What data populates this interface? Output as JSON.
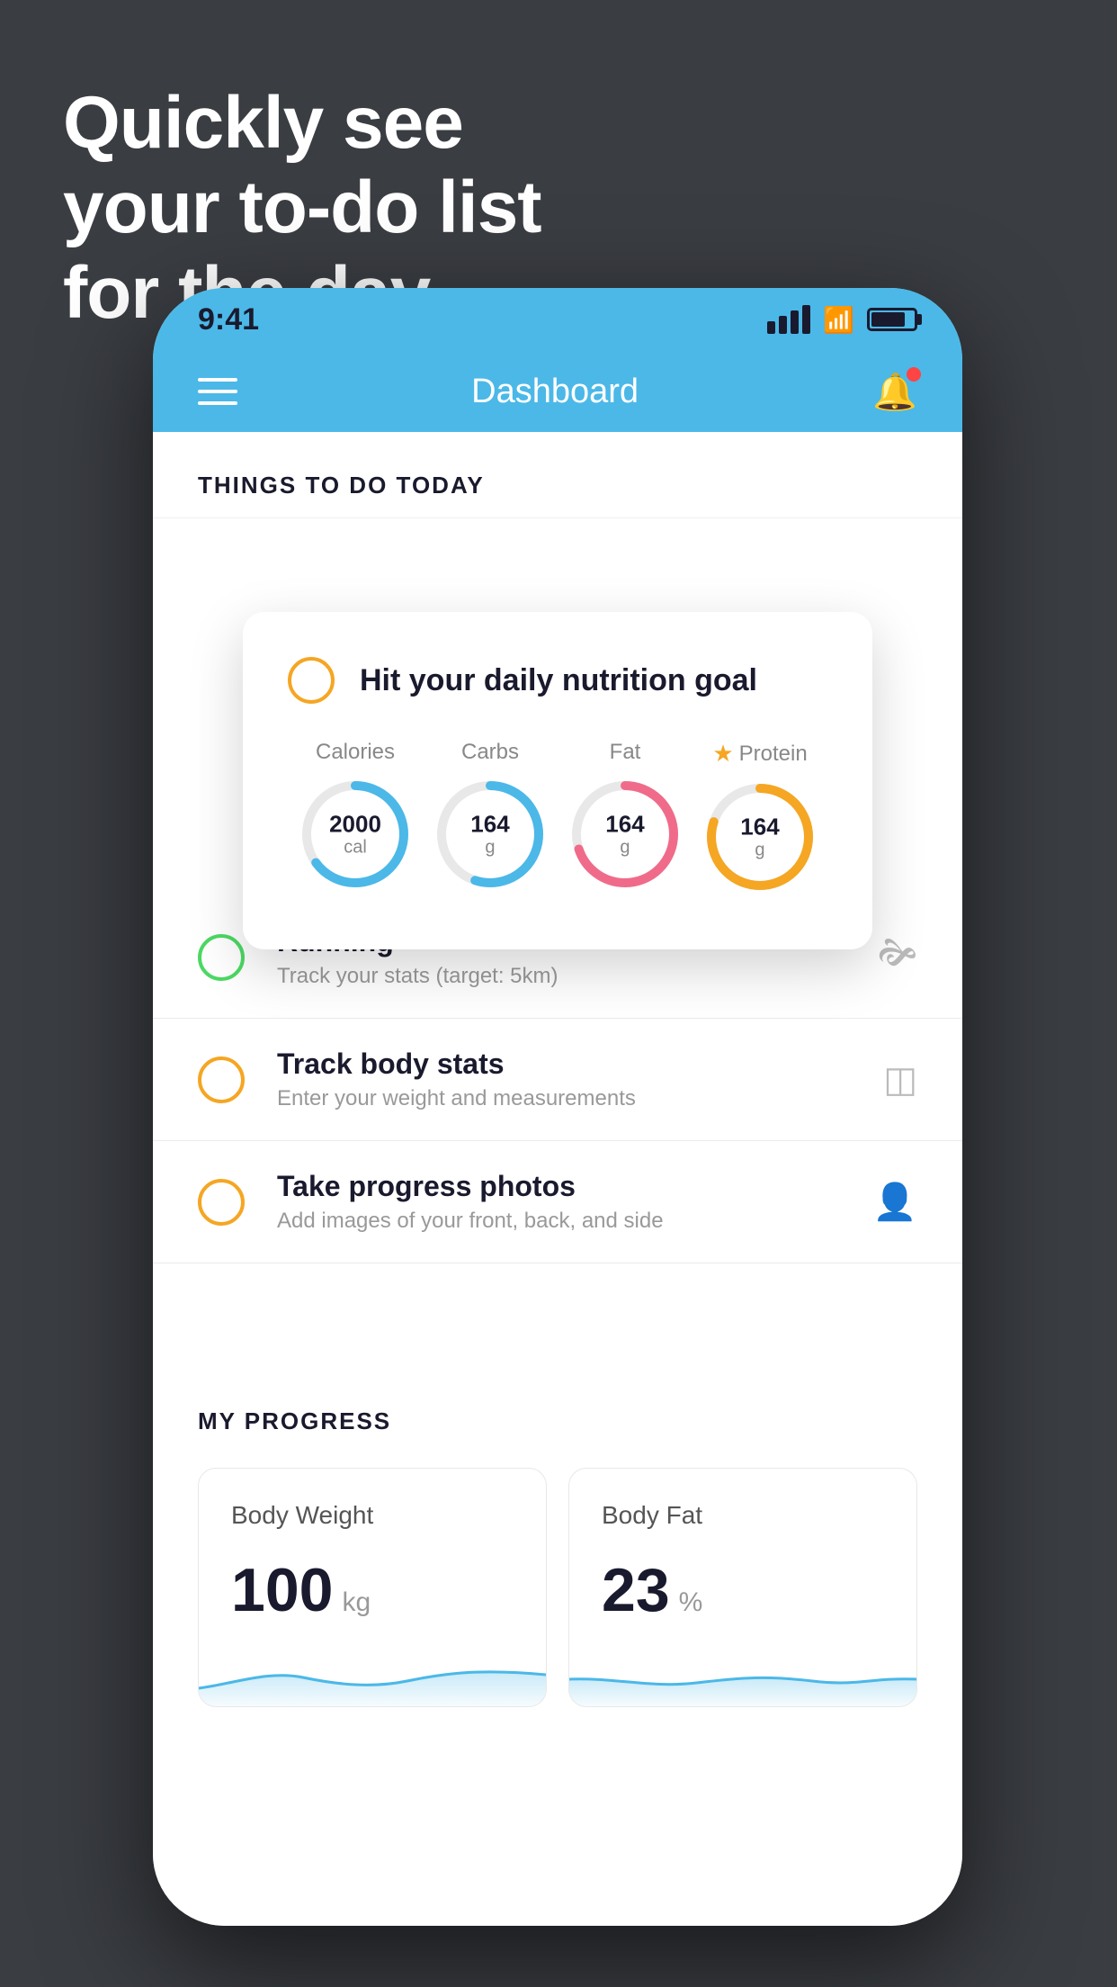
{
  "hero": {
    "line1": "Quickly see",
    "line2": "your to-do list",
    "line3": "for the day."
  },
  "phone": {
    "status": {
      "time": "9:41"
    },
    "header": {
      "title": "Dashboard"
    },
    "things_heading": "THINGS TO DO TODAY",
    "floating_card": {
      "circle_type": "yellow",
      "title": "Hit your daily nutrition goal",
      "nutrition": [
        {
          "label": "Calories",
          "value": "2000",
          "unit": "cal",
          "color": "blue",
          "pct": 0.65,
          "star": false
        },
        {
          "label": "Carbs",
          "value": "164",
          "unit": "g",
          "color": "blue",
          "pct": 0.55,
          "star": false
        },
        {
          "label": "Fat",
          "value": "164",
          "unit": "g",
          "color": "pink",
          "pct": 0.7,
          "star": false
        },
        {
          "label": "Protein",
          "value": "164",
          "unit": "g",
          "color": "gold",
          "pct": 0.8,
          "star": true
        }
      ]
    },
    "todo_items": [
      {
        "id": "running",
        "circle_color": "green",
        "title": "Running",
        "subtitle": "Track your stats (target: 5km)",
        "icon": "shoe"
      },
      {
        "id": "track-body",
        "circle_color": "yellow",
        "title": "Track body stats",
        "subtitle": "Enter your weight and measurements",
        "icon": "scale"
      },
      {
        "id": "progress-photos",
        "circle_color": "yellow",
        "title": "Take progress photos",
        "subtitle": "Add images of your front, back, and side",
        "icon": "person"
      }
    ],
    "my_progress": {
      "heading": "MY PROGRESS",
      "cards": [
        {
          "id": "body-weight",
          "title": "Body Weight",
          "value": "100",
          "unit": "kg"
        },
        {
          "id": "body-fat",
          "title": "Body Fat",
          "value": "23",
          "unit": "%"
        }
      ]
    }
  }
}
